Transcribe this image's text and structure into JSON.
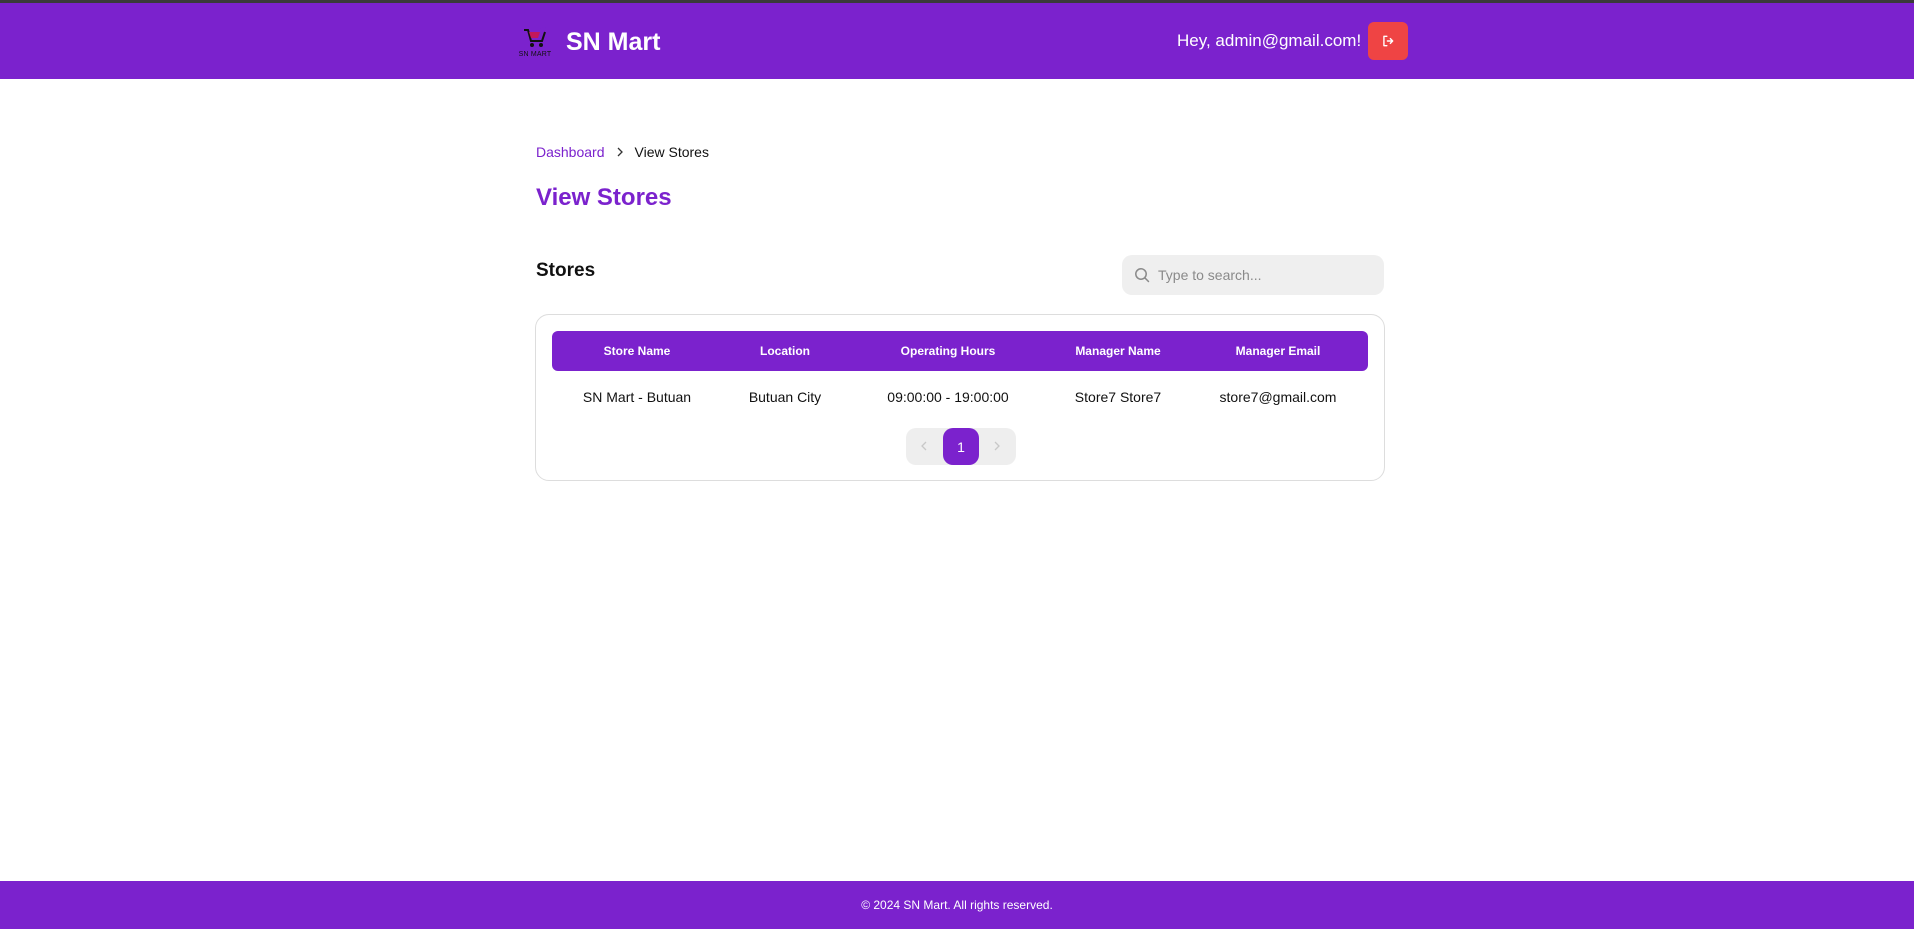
{
  "header": {
    "logo_text": "SN MART",
    "brand": "SN Mart",
    "greeting": "Hey, admin@gmail.com!",
    "logout_icon": "logout-icon"
  },
  "breadcrumb": {
    "items": [
      "Dashboard",
      "View Stores"
    ]
  },
  "page_title": "View Stores",
  "section_title": "Stores",
  "search": {
    "placeholder": "Type to search...",
    "value": ""
  },
  "table": {
    "columns": [
      "Store Name",
      "Location",
      "Operating Hours",
      "Manager Name",
      "Manager Email"
    ],
    "rows": [
      [
        "SN Mart - Butuan",
        "Butuan City",
        "09:00:00 - 19:00:00",
        "Store7 Store7",
        "store7@gmail.com"
      ]
    ]
  },
  "pagination": {
    "current_page": "1"
  },
  "footer": {
    "text": "© 2024 SN Mart. All rights reserved."
  },
  "colors": {
    "brand": "#7b22cd",
    "logout": "#ef4444",
    "footer": "#7b22cd"
  }
}
